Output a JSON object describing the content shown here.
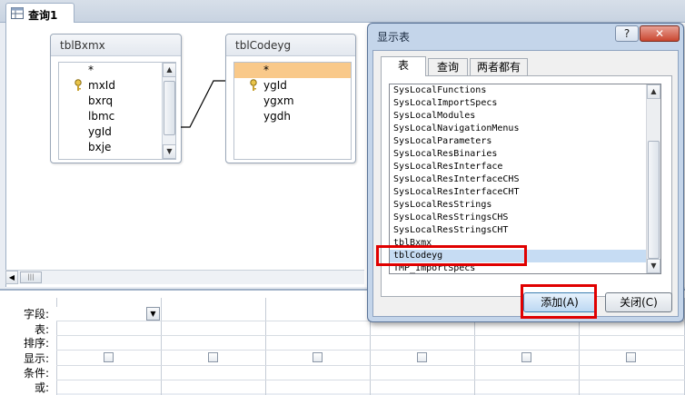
{
  "document_tab": {
    "label": "查询1",
    "icon": "query-icon"
  },
  "tables": [
    {
      "name": "tblBxmx",
      "fields": [
        "*",
        "mxId",
        "bxrq",
        "lbmc",
        "ygId",
        "bxje",
        "·"
      ],
      "key_field": "mxId"
    },
    {
      "name": "tblCodeyg",
      "fields": [
        "*",
        "ygId",
        "ygxm",
        "ygdh"
      ],
      "key_field": "ygId",
      "selected_field": "*"
    }
  ],
  "grid": {
    "row_labels": [
      "字段:",
      "表:",
      "排序:",
      "显示:",
      "条件:",
      "或:"
    ]
  },
  "dialog": {
    "title": "显示表",
    "help_label": "?",
    "close_label": "✕",
    "tabs": [
      "表",
      "查询",
      "两者都有"
    ],
    "active_tab": "表",
    "items": [
      "SysLocalFunctions",
      "SysLocalImportSpecs",
      "SysLocalModules",
      "SysLocalNavigationMenus",
      "SysLocalParameters",
      "SysLocalResBinaries",
      "SysLocalResInterface",
      "SysLocalResInterfaceCHS",
      "SysLocalResInterfaceCHT",
      "SysLocalResStrings",
      "SysLocalResStringsCHS",
      "SysLocalResStringsCHT",
      "tblBxmx",
      "tblCodeyg",
      "TMP_ImportSpecs"
    ],
    "selected_item": "tblCodeyg",
    "add_button": "添加(A)",
    "close_button": "关闭(C)"
  },
  "colors": {
    "highlight": "#e00000",
    "selected_field": "#f9c98a",
    "selected_item": "#c6dcf3"
  }
}
